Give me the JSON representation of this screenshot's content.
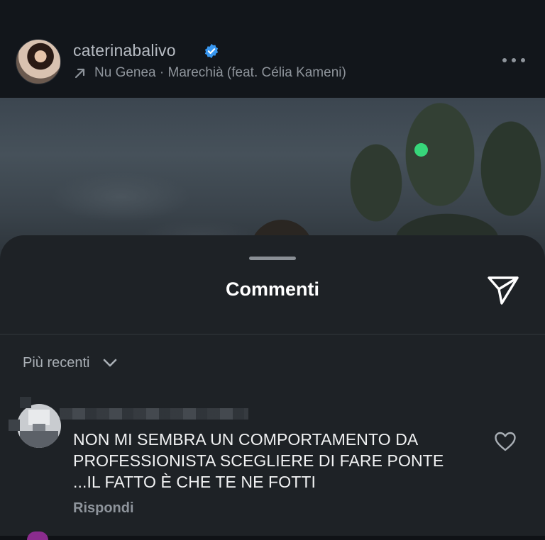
{
  "post": {
    "username": "caterinabalivo",
    "audio": "Nu Genea · Marechià (feat. Célia Kameni)"
  },
  "comments_sheet": {
    "title": "Commenti",
    "sort_label": "Più recenti"
  },
  "comments": [
    {
      "text_lines": [
        "NON MI SEMBRA UN COMPORTAMENTO DA",
        "PROFESSIONISTA SCEGLIERE DI FARE PONTE",
        "...IL FATTO È CHE TE NE FOTTI"
      ],
      "reply_label": "Rispondi"
    }
  ],
  "colors": {
    "verified": "#3897f0",
    "indicator": "#37d67a"
  },
  "icons": [
    "verified-badge-icon",
    "arrow-icon",
    "more-icon",
    "share-icon",
    "chevron-down-icon",
    "heart-icon"
  ]
}
